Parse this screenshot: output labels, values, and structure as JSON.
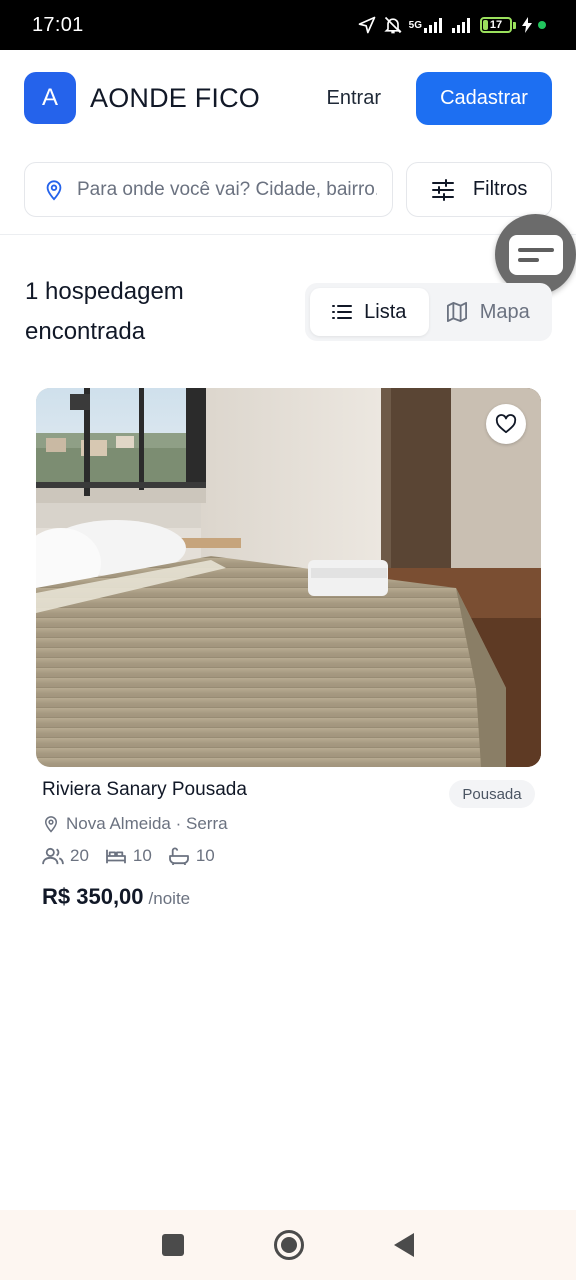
{
  "status_bar": {
    "time": "17:01",
    "network": "5G",
    "battery": "17"
  },
  "header": {
    "logo_letter": "A",
    "brand": "AONDE FICO",
    "login_label": "Entrar",
    "signup_label": "Cadastrar"
  },
  "search": {
    "placeholder": "Para onde você vai? Cidade, bairro...",
    "filters_label": "Filtros"
  },
  "results": {
    "count_text": "1 hospedagem encontrada",
    "view_toggle": {
      "list_label": "Lista",
      "map_label": "Mapa",
      "selected": "Lista"
    }
  },
  "listing": {
    "name": "Riviera Sanary Pousada",
    "type_badge": "Pousada",
    "location": "Nova Almeida · Serra",
    "guests": "20",
    "beds": "10",
    "baths": "10",
    "price": "R$ 350,00",
    "price_unit": "/noite"
  },
  "colors": {
    "primary": "#1d6ff2",
    "text": "#111827",
    "muted": "#6b7280"
  }
}
